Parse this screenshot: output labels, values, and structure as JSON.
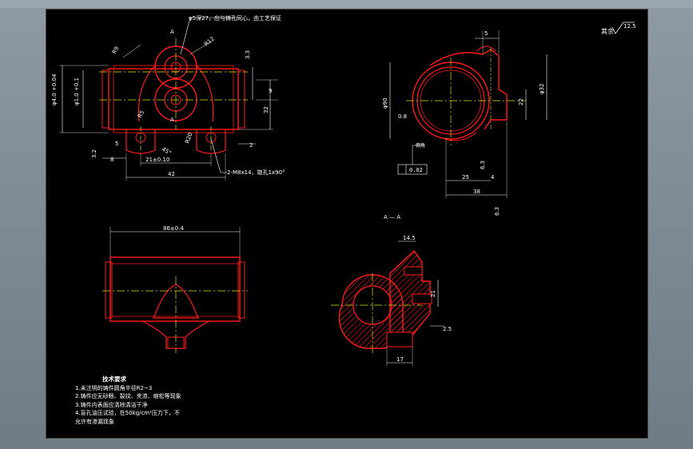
{
  "drawing": {
    "roughness_symbol": "12.5",
    "roughness_label": "其余",
    "section_label": "A — A",
    "section_marker": "A",
    "top_view": {
      "note_hole": "φ5深27，应与铸孔同心，由工艺保证",
      "dim_R9": "R9",
      "dim_R12": "R12",
      "dim_phi_upper": "φ4.0 +0.04",
      "dim_phi_lower": "φ1.0 +0.1",
      "dim_3_3": "3.3",
      "dim_9": "9",
      "dim_32": "32",
      "dim_2": "2",
      "dim_5": "5",
      "dim_8": "8",
      "dim_3_2": "3.2",
      "dim_21": "21±0.10",
      "dim_42": "42",
      "dim_R5": "R5",
      "dim_R20": "R20",
      "dim_45": "45°",
      "thread_note": "2-M8x14，锪孔1x90°"
    },
    "side_view": {
      "dim_5": "5",
      "dim_phi90": "φ90",
      "dim_phi32": "φ32",
      "dim_22": "22",
      "dim_0_8": "0.8",
      "dim_6_3": "6.3",
      "dim_25": "25",
      "dim_4": "4",
      "dim_38": "38",
      "dim_6_3b": "6.3",
      "tolerance": "0.02",
      "note": "倒角"
    },
    "front_view": {
      "dim_86": "86±0.4"
    },
    "section_view": {
      "dim_14_5": "14.5",
      "dim_21": "21",
      "dim_2_5": "2.5",
      "dim_17": "17"
    }
  },
  "notes": {
    "title": "技术要求",
    "items": [
      "1.未注明的铸件圆角半径R2~3",
      "2.铸件应无砂眼、裂纹、夹渣、缩松等现象",
      "3.铸件内表面应清除清洁干净",
      "4.盲孔油压试验，在50kg/cm²压力下，不",
      "允许有渗漏现象"
    ]
  },
  "colors": {
    "outline": "#ff1a1a",
    "center": "#e8e000",
    "dim": "#ffffff",
    "sheet": "#000000"
  }
}
